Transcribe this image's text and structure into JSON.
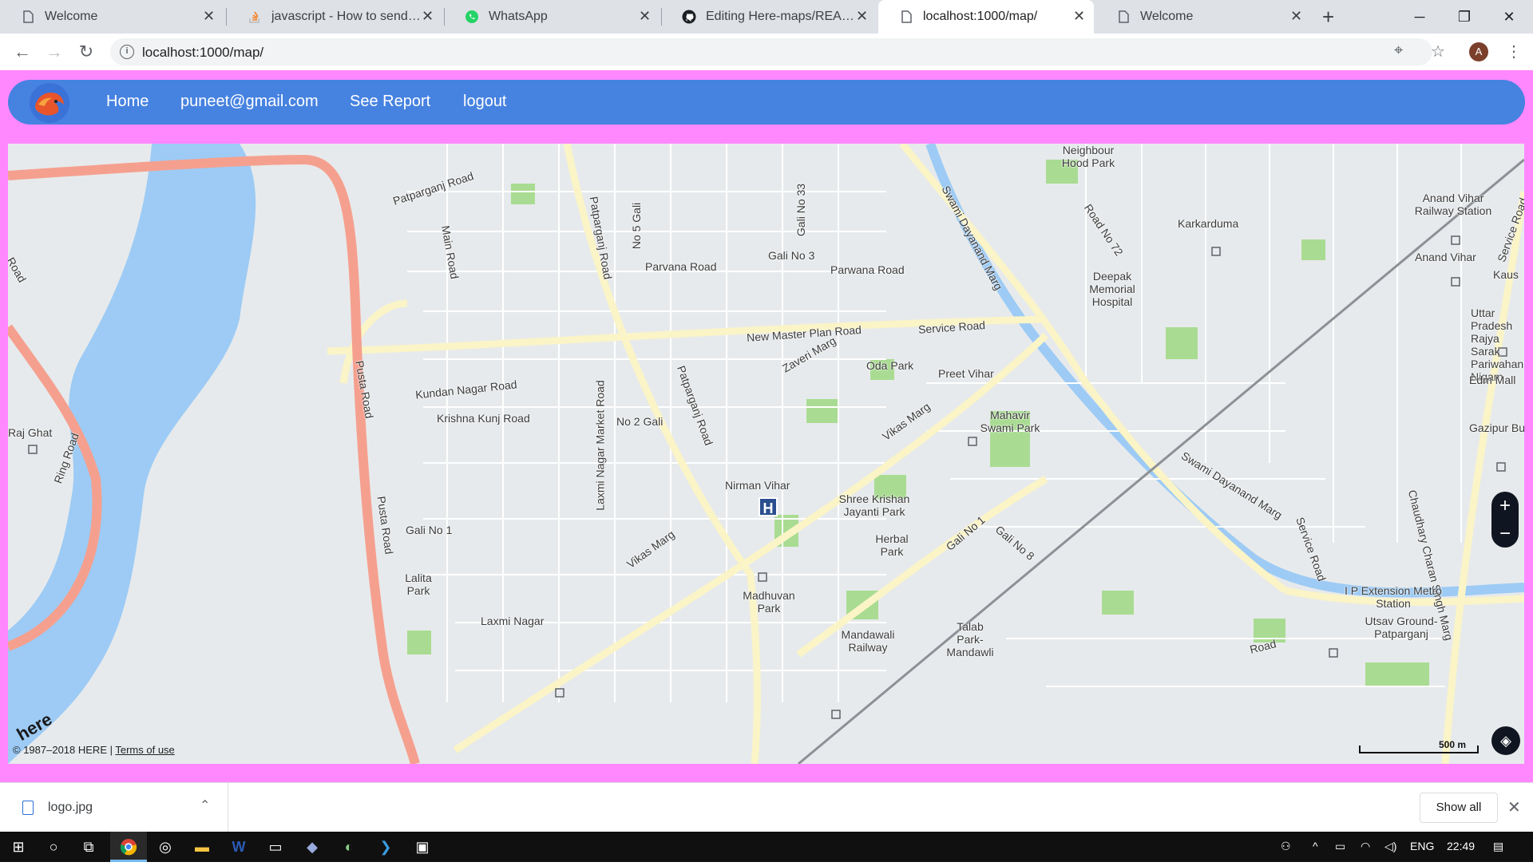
{
  "tabs": [
    {
      "title": "Welcome",
      "icon": "page-icon"
    },
    {
      "title": "javascript - How to send data",
      "icon": "stackoverflow-icon"
    },
    {
      "title": "WhatsApp",
      "icon": "whatsapp-icon"
    },
    {
      "title": "Editing Here-maps/README",
      "icon": "github-icon"
    },
    {
      "title": "localhost:1000/map/",
      "icon": "page-icon"
    },
    {
      "title": "Welcome",
      "icon": "page-icon"
    }
  ],
  "address": {
    "url": "localhost:1000/map/"
  },
  "profile": {
    "initial": "A"
  },
  "nav": {
    "home": "Home",
    "email": "puneet@gmail.com",
    "report": "See Report",
    "logout": "logout"
  },
  "map": {
    "copyright": "© 1987–2018 HERE |",
    "terms": "Terms of use",
    "brand": "here",
    "scale": "500 m",
    "labels": [
      "Patparganj Road",
      "Main Road",
      "No 5 Gali",
      "Gali No 33",
      "Gali No 3",
      "Parvana Road",
      "Parwana Road",
      "Patparganj Road",
      "New Master Plan Road",
      "Service Road",
      "Zaveri Marg",
      "Oda Park",
      "Preet Vihar",
      "Kundan Nagar Road",
      "Krishna Kunj Road",
      "Laxmi Nagar Market Road",
      "No 2 Gali",
      "Patparganj Road",
      "Vikas Marg",
      "Mahavir Swami Park",
      "Nirman Vihar",
      "Shree Krishan Jayanti Park",
      "Herbal Park",
      "Gali No 1",
      "Vikas Marg",
      "Lalita Park",
      "Laxmi Nagar",
      "Madhuvan Park",
      "Mandawali Railway",
      "Talab Park-Mandawli",
      "Gali No 1",
      "Gali No 8",
      "Swami Dayanand Marg",
      "Swami Dayanand Marg",
      "Karkarduma",
      "Deepak Memorial Hospital",
      "Anand Vihar Railway Station",
      "Anand Vihar",
      "Road No 72",
      "Uttar Pradesh Rajya Sarak Pariwahan Nigam",
      "Edm Mall",
      "Gazipur Bus",
      "Chaudhary Charan Singh Marg",
      "Service Road",
      "I P Extension Metro Station",
      "Utsav Ground-Patparganj",
      "Service Road",
      "Kaus",
      "Raj Ghat",
      "Ring Road",
      "Pusta Road",
      "Pusta Road",
      "Road",
      "Neighbour Hood Park",
      "Road"
    ]
  },
  "downloads": {
    "file": "logo.jpg",
    "show_all": "Show all"
  },
  "taskbar": {
    "lang": "ENG",
    "time": "22:49"
  },
  "colors": {
    "page_bg": "#ff88ff",
    "navbar": "#4682e0",
    "water": "#9dcbf5",
    "major_road": "#f5a08f",
    "road": "#faf4c7",
    "park": "#a9dc92"
  }
}
